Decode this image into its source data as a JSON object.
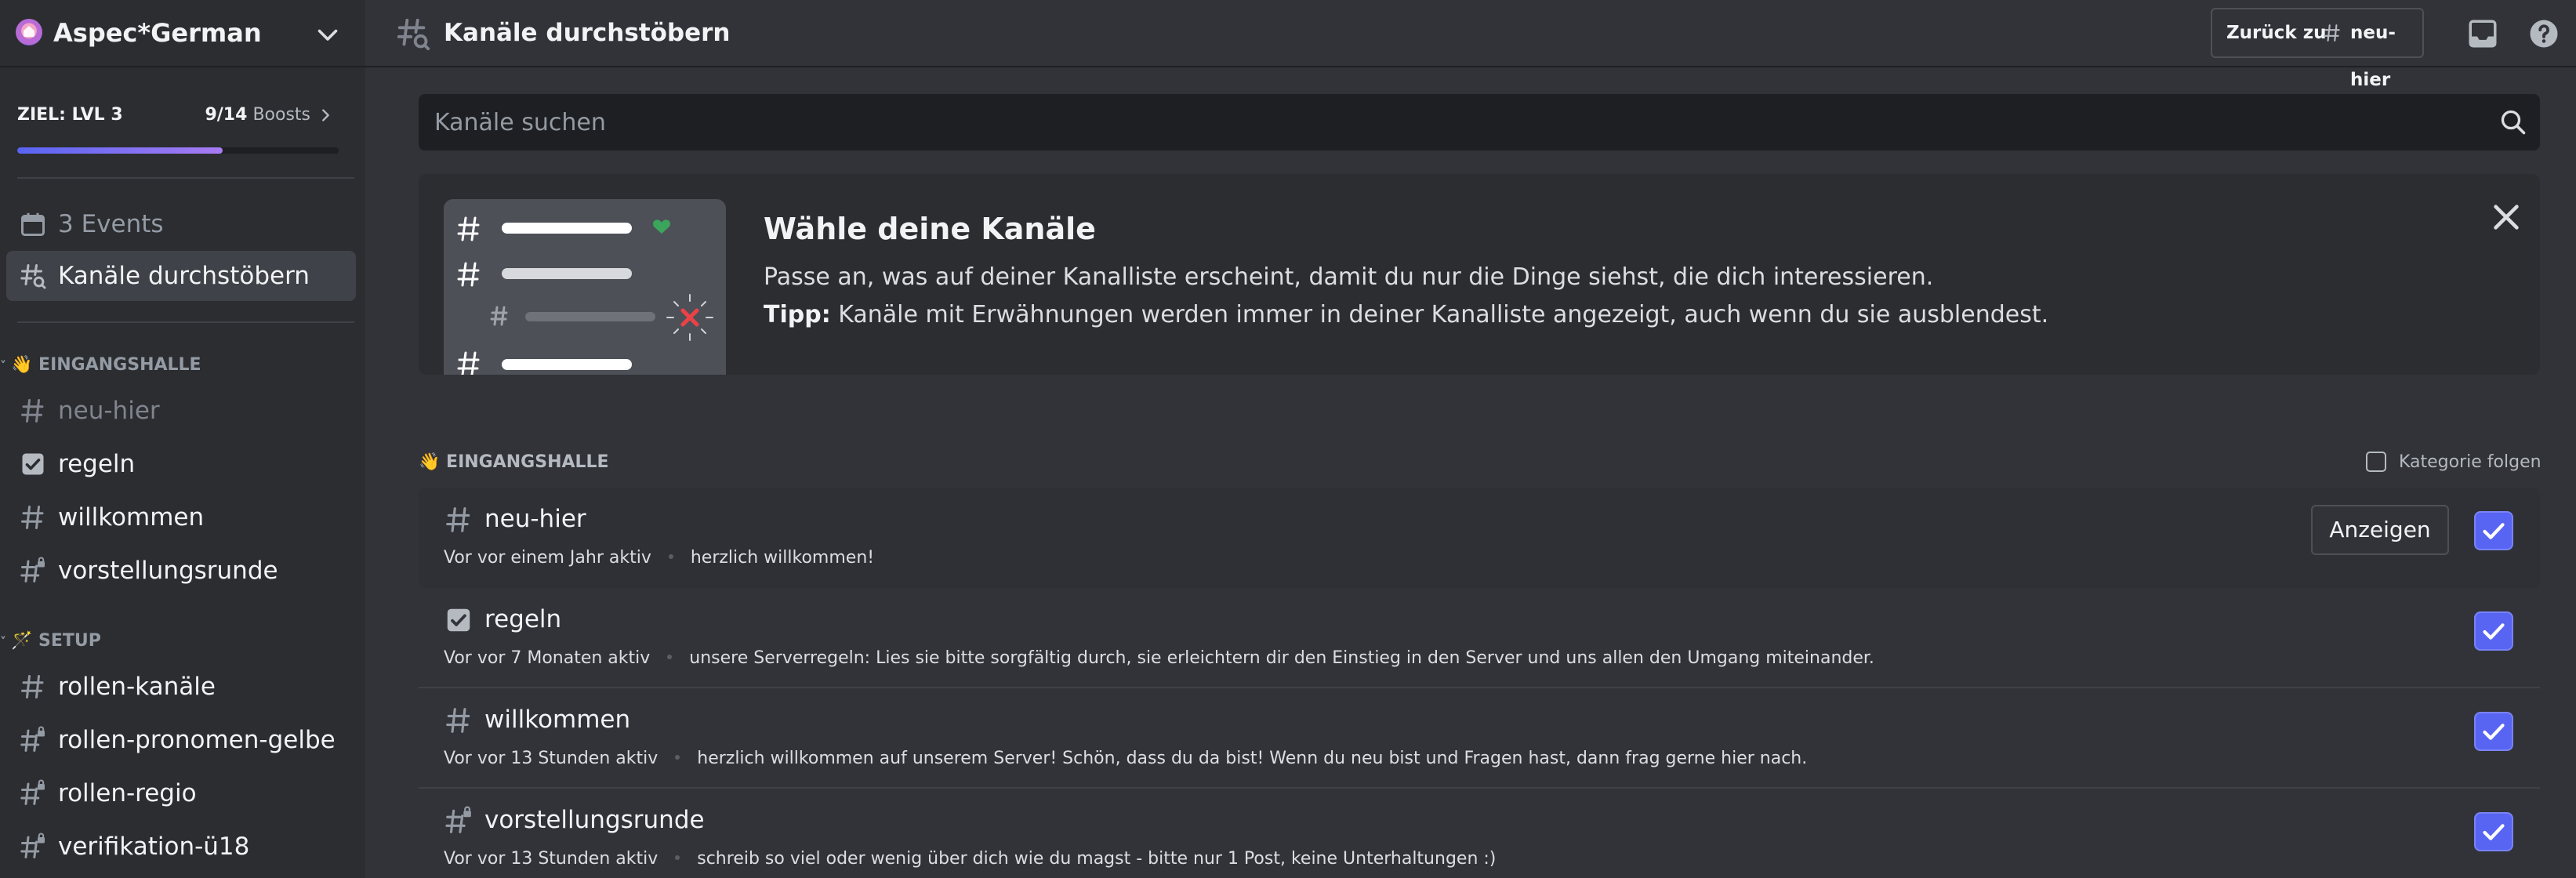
{
  "server": {
    "name": "Aspec*German",
    "boost_goal": "ZIEL: LVL 3",
    "boost_count": "9/14",
    "boost_label": "Boosts",
    "boost_progress": 0.64
  },
  "sidebar": {
    "events_label": "3 Events",
    "browse_label": "Kanäle durchstöbern",
    "categories": [
      {
        "name": "👋 EINGANGSHALLE",
        "channels": [
          "neu-hier",
          "regeln",
          "willkommen",
          "vorstellungsrunde"
        ]
      },
      {
        "name": "🪄 SETUP",
        "channels": [
          "rollen-kanäle",
          "rollen-pronomen-gelbe",
          "rollen-regio",
          "verifikation-ü18"
        ]
      }
    ]
  },
  "topbar": {
    "title": "Kanäle durchstöbern",
    "back_prefix": "Zurück zu",
    "back_channel": "neu-hier"
  },
  "search": {
    "placeholder": "Kanäle suchen"
  },
  "banner": {
    "title": "Wähle deine Kanäle",
    "description": "Passe an, was auf deiner Kanalliste erscheint, damit du nur die Dinge siehst, die dich interessieren.",
    "tip_label": "Tipp:",
    "tip_text": " Kanäle mit Erwähnungen werden immer in deiner Kanalliste angezeigt, auch wenn du sie ausblendest."
  },
  "section": {
    "title": "👋 EINGANGSHALLE",
    "follow_label": "Kategorie folgen",
    "show_button": "Anzeigen",
    "channels": [
      {
        "name": "neu-hier",
        "activity": "Vor vor einem Jahr aktiv",
        "topic": "herzlich willkommen!",
        "icon": "hash-icon",
        "selected": true
      },
      {
        "name": "regeln",
        "activity": "Vor vor 7 Monaten aktiv",
        "topic": "unsere Serverregeln: Lies sie bitte sorgfältig durch, sie erleichtern dir den Einstieg in den Server und uns allen den Umgang miteinander.",
        "icon": "rules-icon",
        "selected": true
      },
      {
        "name": "willkommen",
        "activity": "Vor vor 13 Stunden aktiv",
        "topic": "herzlich willkommen auf unserem Server! Schön, dass du da bist! Wenn du neu bist und Fragen hast, dann frag gerne hier nach.",
        "icon": "hash-icon",
        "selected": true
      },
      {
        "name": "vorstellungsrunde",
        "activity": "Vor vor 13 Stunden aktiv",
        "topic": "schreib so viel oder wenig über dich wie du magst - bitte nur 1 Post, keine Unterhaltungen :)",
        "icon": "hash-lock-icon",
        "selected": true
      }
    ]
  },
  "colors": {
    "accent": "#5865f2",
    "background": "#313338",
    "sidebar": "#2b2d31"
  }
}
